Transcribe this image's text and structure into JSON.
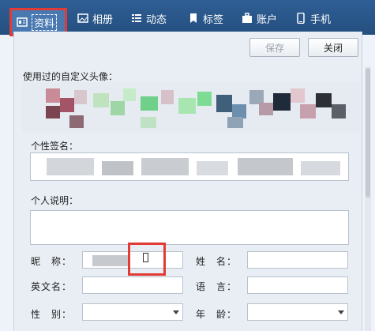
{
  "tabs": [
    {
      "label": "资料",
      "icon": "profile-card-icon",
      "active": true
    },
    {
      "label": "相册",
      "icon": "photo-album-icon",
      "active": false
    },
    {
      "label": "动态",
      "icon": "list-icon",
      "active": false
    },
    {
      "label": "标签",
      "icon": "bookmark-icon",
      "active": false
    },
    {
      "label": "账户",
      "icon": "briefcase-icon",
      "active": false
    },
    {
      "label": "手机",
      "icon": "phone-icon",
      "active": false
    }
  ],
  "toolbar": {
    "save_label": "保存",
    "close_label": "关闭"
  },
  "avatar": {
    "label": "使用过的自定义头像："
  },
  "signature": {
    "label": "个性签名："
  },
  "description": {
    "label": "个人说明："
  },
  "fields": {
    "nickname_label": "昵　称：",
    "name_label": "姓　名：",
    "english_name_label": "英文名：",
    "language_label": "语　言：",
    "gender_label": "性　别：",
    "age_label": "年　龄："
  },
  "colors": {
    "tabbar": "#2f5e96",
    "highlight": "#e23a34"
  }
}
